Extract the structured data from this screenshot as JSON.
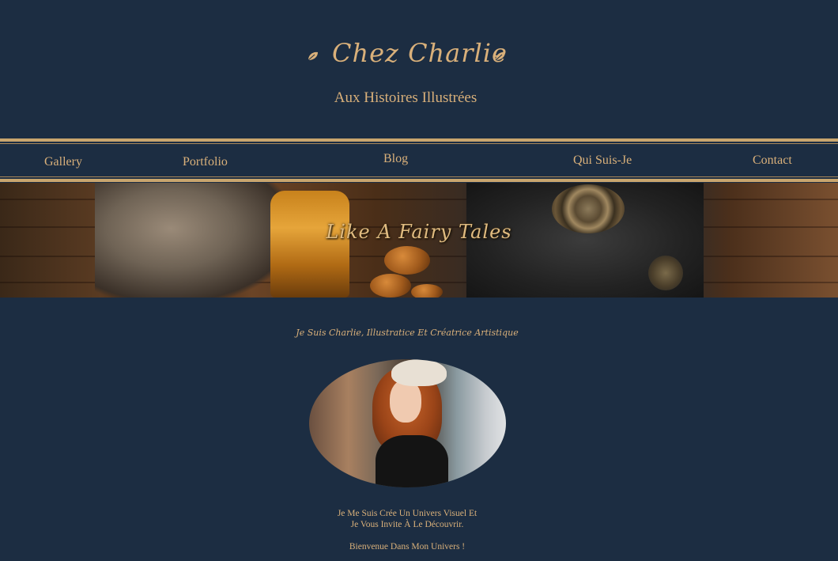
{
  "header": {
    "title": "Chez Charlie",
    "subtitle": "Aux Histoires Illustrées",
    "leaf_icon": "leaf-icon"
  },
  "nav": {
    "items": [
      {
        "label": "Gallery"
      },
      {
        "label": "Portfolio"
      },
      {
        "label": "Blog"
      },
      {
        "label": "Qui Suis-Je"
      },
      {
        "label": "Contact"
      }
    ]
  },
  "banner": {
    "text": "Like A Fairy Tales"
  },
  "intro": {
    "heading": "Je Suis Charlie, Illustratice Et Créatrice Artistique",
    "line1": "Je Me Suis Crée Un Univers Visuel Et",
    "line2": "Je Vous Invite À Le Découvrir.",
    "footer": "Bienvenue Dans Mon Univers !"
  },
  "colors": {
    "background": "#1c2d42",
    "accent": "#d9b07a",
    "nav_border": "#c9a56e"
  }
}
